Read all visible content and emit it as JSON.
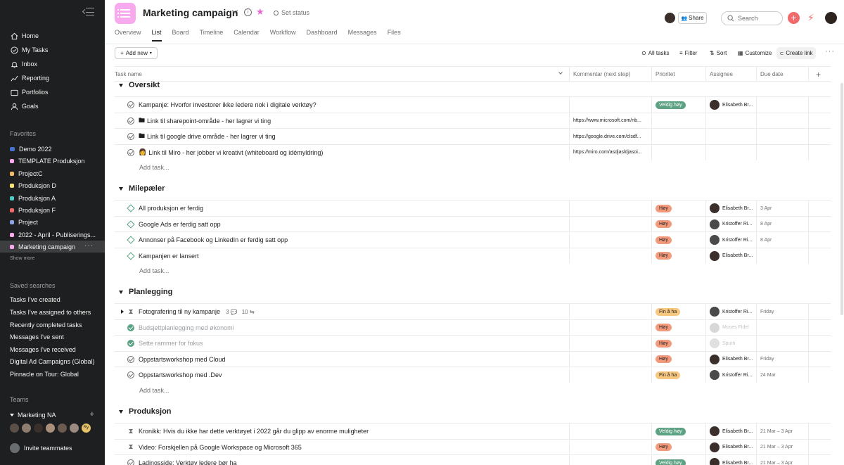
{
  "sidebar": {
    "nav": [
      {
        "label": "Home",
        "icon": "home-icon"
      },
      {
        "label": "My Tasks",
        "icon": "check-circle-icon"
      },
      {
        "label": "Inbox",
        "icon": "bell-icon"
      },
      {
        "label": "Reporting",
        "icon": "chart-icon"
      },
      {
        "label": "Portfolios",
        "icon": "folder-icon"
      },
      {
        "label": "Goals",
        "icon": "person-icon"
      }
    ],
    "favorites_title": "Favorites",
    "favorites": [
      {
        "label": "Demo 2022",
        "color": "#4573d2",
        "kind": "bars"
      },
      {
        "label": "TEMPLATE Produksjon",
        "color": "#f9aaef"
      },
      {
        "label": "ProjectC",
        "color": "#f1bd6c"
      },
      {
        "label": "Produksjon D",
        "color": "#f8df72"
      },
      {
        "label": "Produksjon A",
        "color": "#4ecbc4"
      },
      {
        "label": "Produksjon F",
        "color": "#f06a6a"
      },
      {
        "label": "Project",
        "color": "#8da3e6"
      },
      {
        "label": "2022 - April - Publiserings...",
        "color": "#f9aaef"
      },
      {
        "label": "Marketing campaign",
        "color": "#f9aaef",
        "active": true
      }
    ],
    "show_more": "Show more",
    "saved_title": "Saved searches",
    "saved": [
      "Tasks I've created",
      "Tasks I've assigned to others",
      "Recently completed tasks",
      "Messages I've sent",
      "Messages I've received",
      "Digital Ad Campaigns (Global)",
      "Pinnacle on Tour: Global"
    ],
    "teams_title": "Teams",
    "team_name": "Marketing NA",
    "team_avatar_colors": [
      "#5b4f48",
      "#8f7d70",
      "#3a2f2a",
      "#a98f7c",
      "#6b5a50",
      "#9a8a80",
      "#e8c468"
    ],
    "team_extra_avatar": "Ry",
    "invite": "Invite teammates"
  },
  "header": {
    "title": "Marketing campaign",
    "status": "Set status",
    "tabs": [
      "Overview",
      "List",
      "Board",
      "Timeline",
      "Calendar",
      "Workflow",
      "Dashboard",
      "Messages",
      "Files"
    ],
    "active_tab": "List",
    "share": "Share",
    "search_placeholder": "Search"
  },
  "toolbar": {
    "add_new": "Add new",
    "all_tasks": "All tasks",
    "filter": "Filter",
    "sort": "Sort",
    "customize": "Customize",
    "create_link": "Create link"
  },
  "columns": {
    "task": "Task name",
    "comment": "Kommentar (next step)",
    "priority": "Prioritet",
    "assignee": "Assignee",
    "due": "Due date"
  },
  "add_task": "Add task...",
  "sections": [
    {
      "name": "Oversikt",
      "tasks": [
        {
          "name": "Kampanje: Hvorfor investorer ikke ledere nok i digitale verktøy?",
          "icon": "check",
          "comment": "",
          "priority": "Veldig høy",
          "pclass": "vh",
          "assignee": "Elisabeth Br...",
          "acolor": "#3a2f2a",
          "due": ""
        },
        {
          "name": "Link til sharepoint-område - her lagrer vi ting",
          "emoji": "🖿",
          "icon": "check",
          "comment": "https://www.microsoft.com/nb...",
          "priority": "",
          "assignee": "",
          "due": ""
        },
        {
          "name": "Link til google drive område - her lagrer vi ting",
          "emoji": "🖿",
          "icon": "check",
          "comment": "https://google.drive.com/clsdf...",
          "priority": "",
          "assignee": "",
          "due": ""
        },
        {
          "name": "Link til Miro - her jobber vi kreativt (whiteboard og idémyldring)",
          "emoji": "👩",
          "icon": "check",
          "comment": "https://miro.com/asdjasldjasoi...",
          "priority": "",
          "assignee": "",
          "due": ""
        }
      ]
    },
    {
      "name": "Milepæler",
      "tasks": [
        {
          "name": "All produksjon er ferdig",
          "icon": "diamond",
          "comment": "",
          "priority": "Høy",
          "pclass": "h",
          "assignee": "Elisabeth Br...",
          "acolor": "#3a2f2a",
          "due": "3 Apr"
        },
        {
          "name": "Google Ads er ferdig satt opp",
          "icon": "diamond",
          "comment": "",
          "priority": "Høy",
          "pclass": "h",
          "assignee": "Kristoffer Ri...",
          "acolor": "#4a4a4a",
          "due": "8 Apr"
        },
        {
          "name": "Annonser på Facebook og LinkedIn er ferdig satt opp",
          "icon": "diamond",
          "comment": "",
          "priority": "Høy",
          "pclass": "h",
          "assignee": "Kristoffer Ri...",
          "acolor": "#4a4a4a",
          "due": "8 Apr"
        },
        {
          "name": "Kampanjen er lansert",
          "icon": "diamond",
          "comment": "",
          "priority": "Høy",
          "pclass": "h",
          "assignee": "Elisabeth Br...",
          "acolor": "#3a2f2a",
          "due": ""
        }
      ]
    },
    {
      "name": "Planlegging",
      "tasks": [
        {
          "name": "Fotografering til ny kampanje",
          "icon": "hourglass",
          "expand": true,
          "comments": "3",
          "subtasks": "10",
          "comment": "",
          "priority": "Fin å ha",
          "pclass": "f",
          "assignee": "Kristoffer Ri...",
          "acolor": "#4a4a4a",
          "due": "Friday"
        },
        {
          "name": "Budsjettplanlegging med økonomi",
          "icon": "done",
          "comment": "",
          "priority": "Høy",
          "pclass": "h",
          "assignee": "Moses Fidel",
          "acolor": "#d8d8d8",
          "faded": true,
          "due": ""
        },
        {
          "name": "Sette rammer for fokus",
          "icon": "done",
          "comment": "",
          "priority": "Høy",
          "pclass": "h",
          "assignee": "Spurti",
          "acolor": "#e0e0e0",
          "faded": true,
          "due": ""
        },
        {
          "name": "Oppstartsworkshop med Cloud",
          "icon": "check",
          "comment": "",
          "priority": "Høy",
          "pclass": "h",
          "assignee": "Elisabeth Br...",
          "acolor": "#3a2f2a",
          "due": "Friday"
        },
        {
          "name": "Oppstartsworkshop med .Dev",
          "icon": "check",
          "comment": "",
          "priority": "Fin å ha",
          "pclass": "f",
          "assignee": "Kristoffer Ri...",
          "acolor": "#4a4a4a",
          "due": "24 Mar"
        }
      ]
    },
    {
      "name": "Produksjon",
      "tasks": [
        {
          "name": "Kronikk: Hvis du ikke har dette verktøyet i 2022 går du glipp av enorme muligheter",
          "icon": "hourglass",
          "comment": "",
          "priority": "Veldig høy",
          "pclass": "vh",
          "assignee": "Elisabeth Br...",
          "acolor": "#3a2f2a",
          "due": "21 Mar – 3 Apr"
        },
        {
          "name": "Video: Forskjellen på Google Workspace og Microsoft 365",
          "icon": "hourglass",
          "comment": "",
          "priority": "Høy",
          "pclass": "h",
          "assignee": "Elisabeth Br...",
          "acolor": "#3a2f2a",
          "due": "21 Mar – 3 Apr"
        },
        {
          "name": "Ladingsside: Verktøy ledere bør ha",
          "icon": "check",
          "comment": "",
          "priority": "Veldig høy",
          "pclass": "vh",
          "assignee": "Elisabeth Br...",
          "acolor": "#3a2f2a",
          "due": "21 Mar – 3 Apr"
        }
      ]
    }
  ]
}
